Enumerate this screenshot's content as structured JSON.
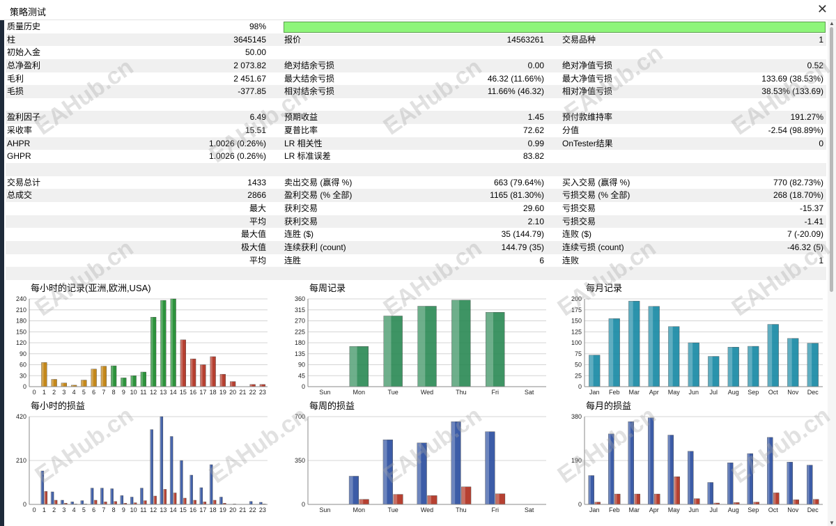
{
  "window": {
    "title": "策略测试",
    "close": "✕"
  },
  "rows": [
    {
      "l1": "质量历史",
      "v1": "98%",
      "bar": true
    },
    {
      "l1": "柱",
      "v1": "3645145",
      "l2": "报价",
      "v2": "14563261",
      "l3": "交易品种",
      "v3": "1"
    },
    {
      "l1": "初始入金",
      "v1": "50.00"
    },
    {
      "l1": "总净盈利",
      "v1": "2 073.82",
      "l2": "绝对结余亏损",
      "v2": "0.00",
      "l3": "绝对净值亏损",
      "v3": "0.52"
    },
    {
      "l1": "毛利",
      "v1": "2 451.67",
      "l2": "最大结余亏损",
      "v2": "46.32 (11.66%)",
      "l3": "最大净值亏损",
      "v3": "133.69 (38.53%)"
    },
    {
      "l1": "毛损",
      "v1": "-377.85",
      "l2": "相对结余亏损",
      "v2": "11.66% (46.32)",
      "l3": "相对净值亏损",
      "v3": "38.53% (133.69)"
    },
    {},
    {
      "l1": "盈利因子",
      "v1": "6.49",
      "l2": "预期收益",
      "v2": "1.45",
      "l3": "预付款维持率",
      "v3": "191.27%"
    },
    {
      "l1": "采收率",
      "v1": "15.51",
      "l2": "夏普比率",
      "v2": "72.62",
      "l3": "分值",
      "v3": "-2.54 (98.89%)"
    },
    {
      "l1": "AHPR",
      "v1": "1.0026 (0.26%)",
      "l2": "LR 相关性",
      "v2": "0.99",
      "l3": "OnTester结果",
      "v3": "0"
    },
    {
      "l1": "GHPR",
      "v1": "1.0026 (0.26%)",
      "l2": "LR 标准误差",
      "v2": "83.82"
    },
    {},
    {
      "l1": "交易总计",
      "v1": "1433",
      "l2": "卖出交易 (赢得 %)",
      "v2": "663 (79.64%)",
      "l3": "买入交易 (赢得 %)",
      "v3": "770 (82.73%)"
    },
    {
      "l1": "总成交",
      "v1": "2866",
      "l2": "盈利交易 (% 全部)",
      "v2": "1165 (81.30%)",
      "l3": "亏损交易 (% 全部)",
      "v3": "268 (18.70%)"
    },
    {
      "v1": "最大",
      "l2": "获利交易",
      "v2": "29.60",
      "l3": "亏损交易",
      "v3": "-15.37"
    },
    {
      "v1": "平均",
      "l2": "获利交易",
      "v2": "2.10",
      "l3": "亏损交易",
      "v3": "-1.41"
    },
    {
      "v1": "最大值",
      "l2": "连胜 ($)",
      "v2": "35 (144.79)",
      "l3": "连败 ($)",
      "v3": "7 (-20.09)"
    },
    {
      "v1": "极大值",
      "l2": "连续获利 (count)",
      "v2": "144.79 (35)",
      "l3": "连续亏损 (count)",
      "v3": "-46.32 (5)"
    },
    {
      "v1": "平均",
      "l2": "连胜",
      "v2": "6",
      "l3": "连败",
      "v3": "1"
    },
    {}
  ],
  "watermark": "EAHub.cn",
  "chart_data": [
    {
      "type": "bar",
      "title": "每小时的记录(亚洲,欧洲,USA)",
      "categories": [
        "0",
        "1",
        "2",
        "3",
        "4",
        "5",
        "6",
        "7",
        "8",
        "9",
        "10",
        "11",
        "12",
        "13",
        "14",
        "15",
        "16",
        "17",
        "18",
        "19",
        "20",
        "21",
        "22",
        "23"
      ],
      "values": [
        0,
        66,
        20,
        10,
        4,
        18,
        48,
        56,
        57,
        24,
        30,
        40,
        190,
        236,
        240,
        128,
        76,
        60,
        82,
        34,
        14,
        0,
        6,
        6
      ],
      "yticks": [
        "0",
        "30",
        "60",
        "90",
        "120",
        "150",
        "180",
        "210",
        "240"
      ],
      "ylim": [
        0,
        240
      ],
      "colors": [
        "#c07e08",
        "#c07e08",
        "#c07e08",
        "#c07e08",
        "#c07e08",
        "#c07e08",
        "#c07e08",
        "#c07e08",
        "#1c8a2c",
        "#1c8a2c",
        "#1c8a2c",
        "#1c8a2c",
        "#1c8a2c",
        "#1c8a2c",
        "#1c8a2c",
        "#b03020",
        "#b03020",
        "#b03020",
        "#b03020",
        "#b03020",
        "#b03020",
        "#b03020",
        "#b03020",
        "#b03020"
      ]
    },
    {
      "type": "bar",
      "title": "每周记录",
      "categories": [
        "Sun",
        "Mon",
        "Tue",
        "Wed",
        "Thu",
        "Fri",
        "Sat"
      ],
      "values": [
        0,
        165,
        290,
        330,
        355,
        305,
        0
      ],
      "yticks": [
        "0",
        "45",
        "90",
        "135",
        "180",
        "225",
        "270",
        "315",
        "360"
      ],
      "ylim": [
        0,
        360
      ],
      "colors": [
        "#2e8b57"
      ]
    },
    {
      "type": "bar",
      "title": "每月记录",
      "categories": [
        "Jan",
        "Feb",
        "Mar",
        "Apr",
        "May",
        "Jun",
        "Jul",
        "Aug",
        "Sep",
        "Oct",
        "Nov",
        "Dec"
      ],
      "values": [
        72,
        155,
        195,
        183,
        137,
        100,
        69,
        90,
        92,
        142,
        110,
        99
      ],
      "yticks": [
        "0",
        "25",
        "50",
        "75",
        "100",
        "125",
        "150",
        "175",
        "200"
      ],
      "ylim": [
        0,
        200
      ],
      "colors": [
        "#1a8aa5"
      ]
    },
    {
      "type": "bar",
      "title": "每小时的损益",
      "categories": [
        "0",
        "1",
        "2",
        "3",
        "4",
        "5",
        "6",
        "7",
        "8",
        "9",
        "10",
        "11",
        "12",
        "13",
        "14",
        "15",
        "16",
        "17",
        "18",
        "19",
        "20",
        "21",
        "22",
        "23"
      ],
      "series": [
        {
          "values": [
            0,
            160,
            60,
            20,
            12,
            18,
            78,
            78,
            75,
            42,
            35,
            78,
            358,
            420,
            325,
            210,
            140,
            80,
            190,
            35,
            0,
            0,
            14,
            10
          ]
        },
        {
          "values": [
            0,
            62,
            20,
            6,
            2,
            2,
            20,
            12,
            14,
            6,
            8,
            18,
            40,
            72,
            55,
            30,
            20,
            12,
            20,
            6,
            2,
            0,
            0,
            2
          ]
        }
      ],
      "yticks": [
        "0",
        "210",
        "420"
      ],
      "ylim": [
        0,
        420
      ],
      "colors": [
        "#2c4fa0",
        "#b03020"
      ]
    },
    {
      "type": "bar",
      "title": "每周的损益",
      "categories": [
        "Sun",
        "Mon",
        "Tue",
        "Wed",
        "Thu",
        "Fri",
        "Sat"
      ],
      "series": [
        {
          "values": [
            0,
            225,
            515,
            490,
            660,
            580,
            0
          ]
        },
        {
          "values": [
            0,
            40,
            80,
            70,
            140,
            85,
            0
          ]
        }
      ],
      "yticks": [
        "0",
        "350",
        "700"
      ],
      "ylim": [
        0,
        700
      ],
      "colors": [
        "#2c4fa0",
        "#b03020"
      ]
    },
    {
      "type": "bar",
      "title": "每月的损益",
      "categories": [
        "Jan",
        "Feb",
        "Mar",
        "Apr",
        "May",
        "Jun",
        "Jul",
        "Aug",
        "Sep",
        "Oct",
        "Nov",
        "Dec"
      ],
      "series": [
        {
          "values": [
            125,
            305,
            358,
            375,
            300,
            230,
            95,
            180,
            220,
            290,
            183,
            170
          ]
        },
        {
          "values": [
            10,
            45,
            45,
            45,
            120,
            25,
            6,
            8,
            10,
            50,
            20,
            22
          ]
        }
      ],
      "yticks": [
        "0",
        "190",
        "380"
      ],
      "ylim": [
        0,
        380
      ],
      "colors": [
        "#2c4fa0",
        "#b03020"
      ]
    }
  ]
}
